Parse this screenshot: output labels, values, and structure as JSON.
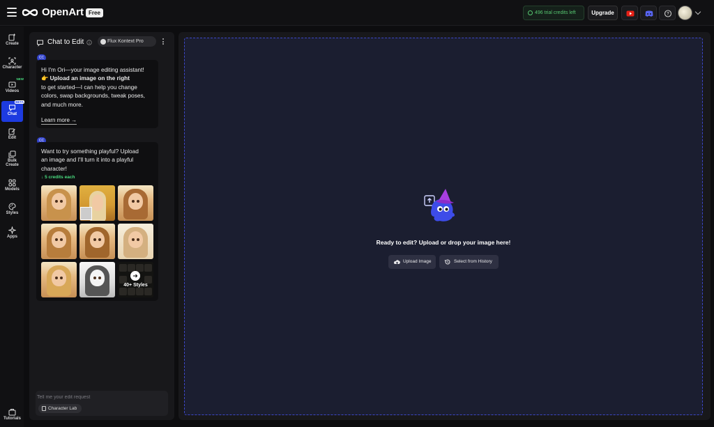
{
  "header": {
    "brand": "OpenArt",
    "plan_badge": "Free",
    "credits": "496 trial credits left",
    "upgrade": "Upgrade"
  },
  "nav": {
    "items": [
      {
        "label": "Create",
        "icon": "create-icon"
      },
      {
        "label": "Character",
        "icon": "character-icon"
      },
      {
        "label": "Videos",
        "icon": "video-icon",
        "badge": "NEW"
      },
      {
        "label": "Chat",
        "icon": "chat-icon",
        "badge": "BETA",
        "active": true
      },
      {
        "label": "Edit",
        "icon": "edit-icon"
      },
      {
        "label": "Bulk",
        "label2": "Create",
        "icon": "bulk-create-icon"
      },
      {
        "label": "Models",
        "icon": "models-icon"
      },
      {
        "label": "Styles",
        "icon": "styles-icon"
      },
      {
        "label": "Apps",
        "icon": "apps-icon"
      }
    ],
    "tutorials": "Tutorials"
  },
  "chat": {
    "title": "Chat to Edit",
    "model": "Flux Kontext Pro",
    "bot_avatar": "CC",
    "message1": {
      "line1": "Hi I'm Ori—your image editing assistant!",
      "line2_emoji": "👉",
      "line2_bold": "Upload an image on the right",
      "line3": "to get started—I can help you change",
      "line4": "colors, swap backgrounds, tweak poses,",
      "line5": "and much more.",
      "link": "Learn more",
      "link_arrow": "→"
    },
    "message2": {
      "line1": "Want to try something playful? Upload",
      "line2": "an image and I'll turn it into a playful",
      "line3": "character!",
      "credits": "5 credits each",
      "more_label": "40+ Styles",
      "more_arrow": "➜"
    },
    "input_placeholder": "Tell me your edit request",
    "chip": "Character Lab"
  },
  "canvas": {
    "prompt": "Ready to edit? Upload or drop your image here!",
    "upload": "Upload Image",
    "history": "Select from History"
  },
  "colors": {
    "accent": "#1d3be0",
    "credit_green": "#4ade80",
    "drop_border": "#3d47c8"
  }
}
